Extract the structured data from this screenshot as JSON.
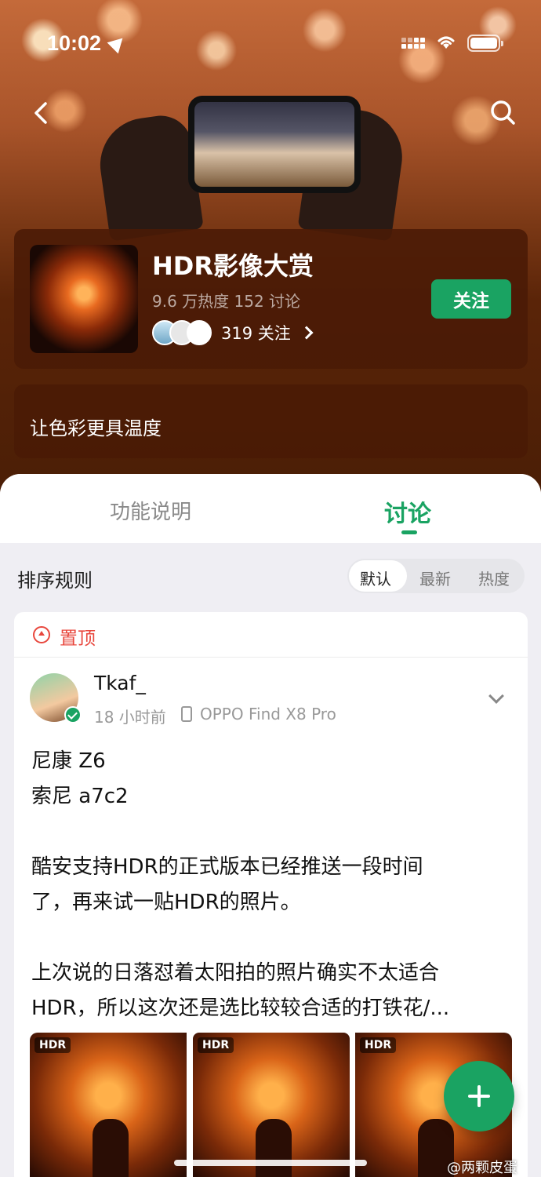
{
  "status_bar": {
    "time": "10:02"
  },
  "topic": {
    "title": "HDR影像大赏",
    "meta": "9.6 万热度 152 讨论",
    "followers": "319 关注",
    "follow_label": "关注",
    "description": "让色彩更具温度"
  },
  "tabs": [
    {
      "label": "功能说明",
      "active": false
    },
    {
      "label": "讨论",
      "active": true
    }
  ],
  "sort": {
    "label": "排序规则",
    "options": [
      "默认",
      "最新",
      "热度"
    ],
    "selected": "默认"
  },
  "post": {
    "pinned_label": "置顶",
    "author": "Tkaf_",
    "time": "18 小时前",
    "device": "OPPO Find X8 Pro",
    "body_lines": [
      "尼康 Z6",
      "索尼 a7c2",
      "",
      "酷安支持HDR的正式版本已经推送一段时间",
      "了，再来试一贴HDR的照片。",
      "",
      "上次说的日落怼着太阳拍的照片确实不太适合",
      "HDR，所以这次还是选比较较合适的打铁花/..."
    ],
    "image_badges": [
      "HDR",
      "HDR",
      "HDR"
    ]
  },
  "watermark": "@两颗皮蛋",
  "colors": {
    "accent": "#1aa362",
    "pin_red": "#e8473d",
    "card_bg": "#4a1a06"
  },
  "icons": [
    "back-icon",
    "search-icon",
    "location-arrow-icon",
    "cellular-icon",
    "wifi-icon",
    "battery-icon",
    "chevron-right-icon",
    "pin-icon",
    "verified-icon",
    "phone-device-icon",
    "chevron-down-icon",
    "plus-icon"
  ]
}
